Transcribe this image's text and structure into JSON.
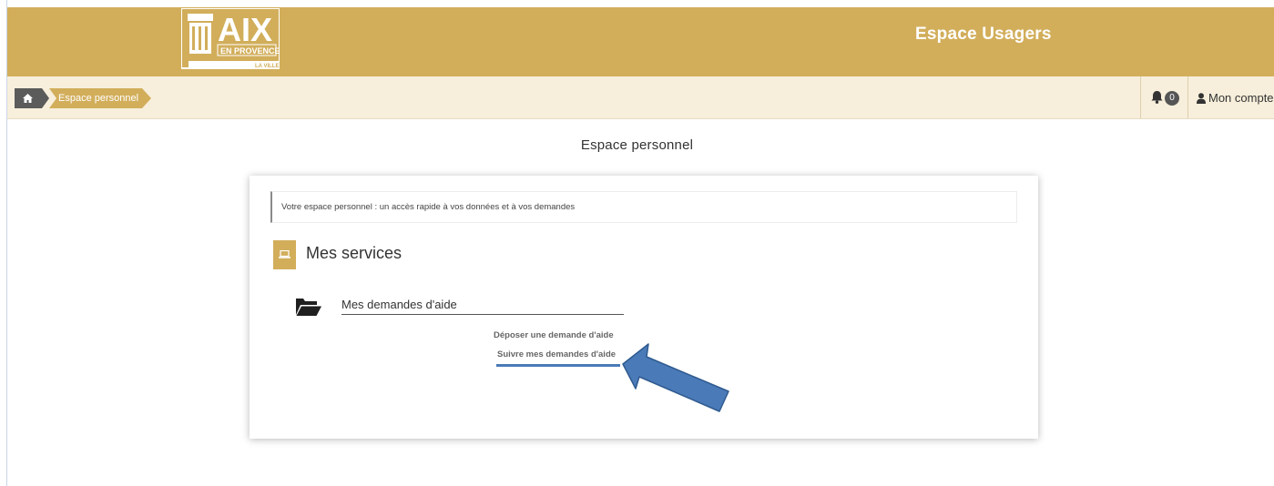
{
  "header": {
    "logo": {
      "main": "AIX",
      "sub": "EN PROVENCE",
      "tag": "LA VILLE"
    },
    "title": "Espace Usagers"
  },
  "breadcrumb": {
    "home_icon": "home-icon",
    "current": "Espace personnel"
  },
  "toolbar": {
    "notification_count": "0",
    "account_label": "Mon compte"
  },
  "page": {
    "title": "Espace personnel"
  },
  "card": {
    "intro": "Votre espace personnel : un accès rapide à vos données et à vos demandes",
    "services_title": "Mes services",
    "group": {
      "title": "Mes demandes d'aide",
      "links": [
        "Déposer une demande d'aide",
        "Suivre mes demandes d'aide"
      ]
    }
  },
  "colors": {
    "brand_gold": "#d2ae5b",
    "bar_cream": "#f7efdb",
    "annotation_blue": "#4a7ab7"
  }
}
